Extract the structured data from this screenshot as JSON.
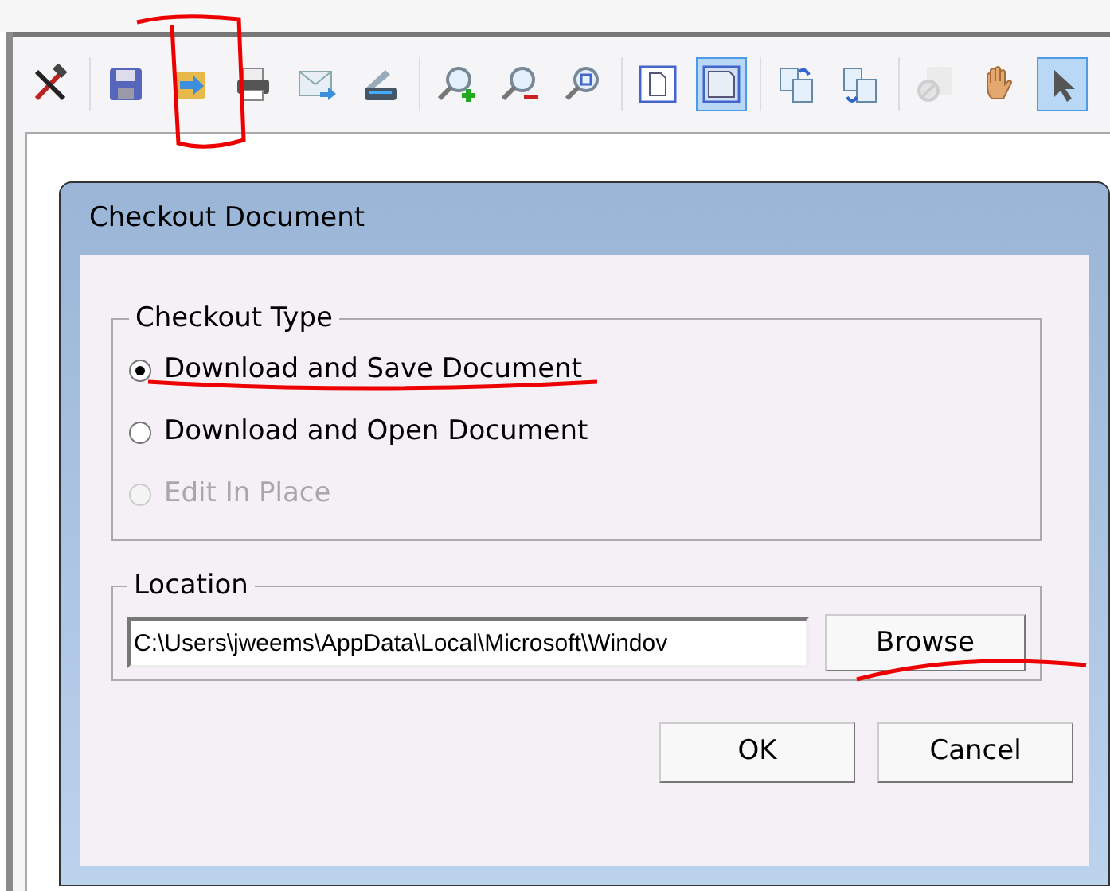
{
  "toolbar": {
    "groups": [
      [
        {
          "kind": "tools",
          "selected": false,
          "disabled": false
        }
      ],
      [
        {
          "kind": "save",
          "selected": false,
          "disabled": false
        },
        {
          "kind": "export",
          "selected": false,
          "disabled": false
        },
        {
          "kind": "print",
          "selected": false,
          "disabled": false
        },
        {
          "kind": "email",
          "selected": false,
          "disabled": false
        },
        {
          "kind": "scan",
          "selected": false,
          "disabled": false
        }
      ],
      [
        {
          "kind": "zoom-in",
          "selected": false,
          "disabled": false
        },
        {
          "kind": "zoom-out",
          "selected": false,
          "disabled": false
        },
        {
          "kind": "zoom-fit",
          "selected": false,
          "disabled": false
        }
      ],
      [
        {
          "kind": "page",
          "selected": false,
          "disabled": false
        },
        {
          "kind": "page-fit",
          "selected": true,
          "disabled": false
        }
      ],
      [
        {
          "kind": "rotate-left",
          "selected": false,
          "disabled": false
        },
        {
          "kind": "rotate-right",
          "selected": false,
          "disabled": false
        }
      ],
      [
        {
          "kind": "block",
          "selected": false,
          "disabled": true
        },
        {
          "kind": "hand",
          "selected": false,
          "disabled": false
        },
        {
          "kind": "pointer",
          "selected": true,
          "disabled": false
        }
      ]
    ]
  },
  "dialog": {
    "title": "Checkout Document",
    "checkout_type": {
      "label": "Checkout Type",
      "options": [
        {
          "label": "Download and Save Document",
          "selected": true,
          "disabled": false
        },
        {
          "label": "Download and Open Document",
          "selected": false,
          "disabled": false
        },
        {
          "label": "Edit In Place",
          "selected": false,
          "disabled": true
        }
      ]
    },
    "location": {
      "label": "Location",
      "value": "C:\\Users\\jweems\\AppData\\Local\\Microsoft\\Windov",
      "browse": "Browse"
    },
    "buttons": [
      "OK",
      "Cancel"
    ]
  }
}
